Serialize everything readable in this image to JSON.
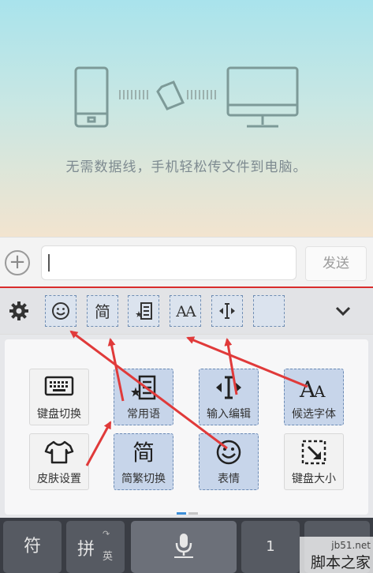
{
  "hero": {
    "caption": "无需数据线，手机轻松传文件到电脑。"
  },
  "message_bar": {
    "input_value": "",
    "send_label": "发送"
  },
  "toolbar": {
    "simplified_label": "简",
    "font_label": "AA"
  },
  "panel": {
    "buttons": [
      {
        "label": "键盘切换",
        "icon": "keyboard-icon",
        "highlighted": false
      },
      {
        "label": "常用语",
        "icon": "phrase-list-icon",
        "highlighted": true
      },
      {
        "label": "输入编辑",
        "icon": "cursor-edit-icon",
        "highlighted": true
      },
      {
        "label": "候选字体",
        "icon": "font-icon",
        "highlighted": true
      },
      {
        "label": "皮肤设置",
        "icon": "tshirt-icon",
        "highlighted": false
      },
      {
        "label": "简繁切换",
        "icon": "simplified-traditional-icon",
        "highlighted": true,
        "icon_text": "简"
      },
      {
        "label": "表情",
        "icon": "smiley-icon",
        "highlighted": true
      },
      {
        "label": "键盘大小",
        "icon": "resize-icon",
        "highlighted": false
      }
    ],
    "page_indicator": {
      "count": 2,
      "active": 1
    }
  },
  "bottom_keys": {
    "symbol_label": "符",
    "pinyin_label": "拼",
    "english_label": "英",
    "number_label": "1"
  },
  "watermark": {
    "line1": "jb51.net",
    "line2": "脚本之家"
  },
  "colors": {
    "highlight_fill": "#c7d5ea",
    "annotation_arrow": "#e03a3a",
    "divider_red": "#d92c2c",
    "page_dot_active": "#3d8fd8"
  }
}
